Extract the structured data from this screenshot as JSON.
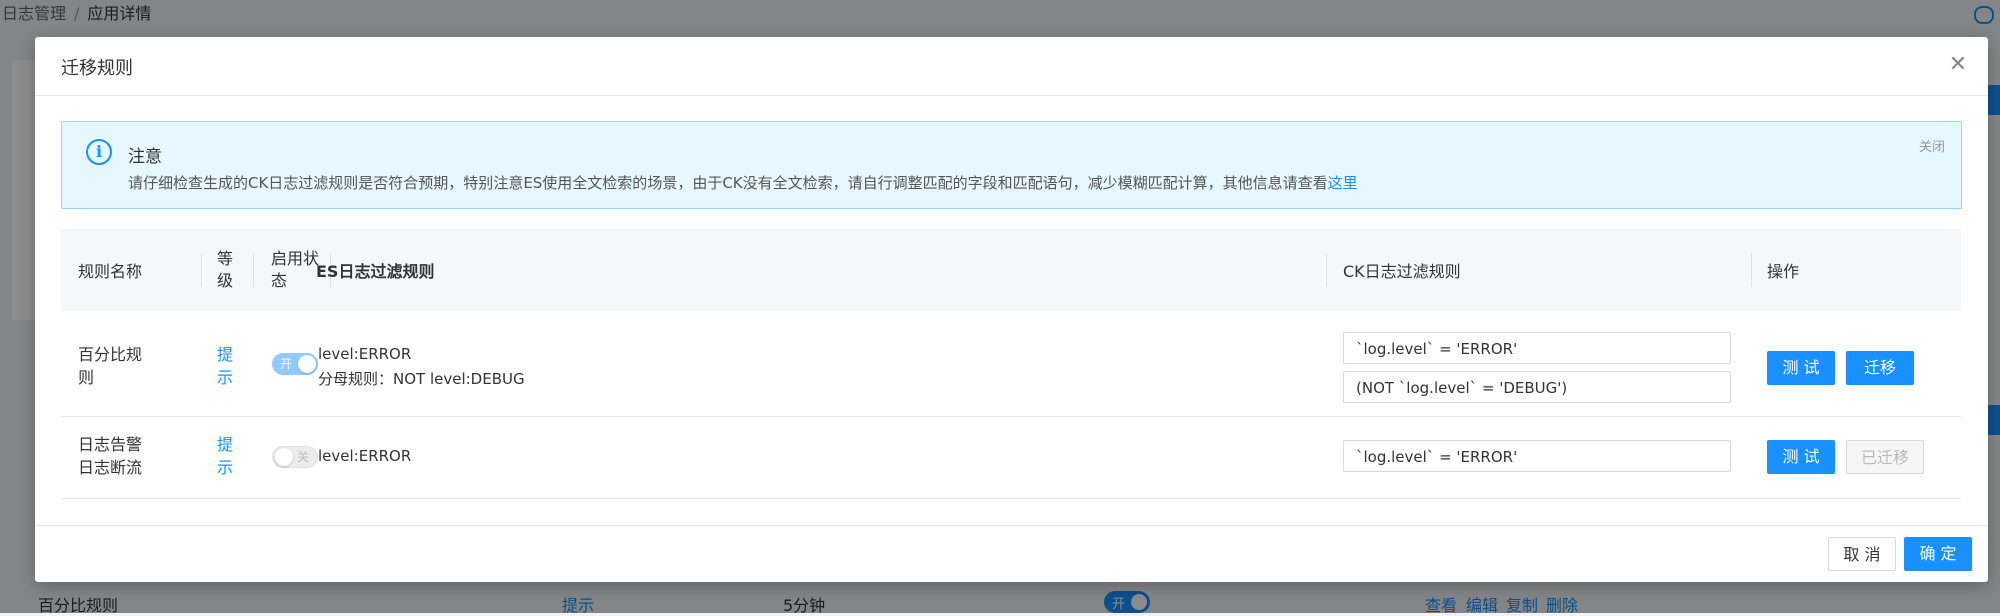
{
  "background": {
    "breadcrumb": [
      "日志管理",
      "应用详情"
    ],
    "breadcrumb_sep": "/",
    "row": {
      "name": "百分比规则",
      "hint": "提示",
      "interval": "5分钟",
      "toggle": "开",
      "actions": [
        "查看",
        "编辑",
        "复制",
        "删除"
      ]
    }
  },
  "modal": {
    "title": "迁移规则",
    "close_icon": "close-icon",
    "alert": {
      "icon": "info-icon",
      "title": "注意",
      "description": "请仔细检查生成的CK日志过滤规则是否符合预期，特别注意ES使用全文检索的场景，由于CK没有全文检索，请自行调整匹配的字段和匹配语句，减少模糊匹配计算，其他信息请查看",
      "link_text": "这里",
      "close_label": "关闭"
    },
    "table": {
      "headers": {
        "name": "规则名称",
        "level": "等级",
        "status": "启用状态",
        "es_rule": "ES日志过滤规则",
        "ck_rule": "CK日志过滤规则",
        "action": "操作"
      },
      "rows": [
        {
          "name": "百分比规则",
          "level": "提示",
          "enabled": true,
          "toggle_text": "开",
          "es_rule": [
            "level:ERROR",
            "分母规则：NOT level:DEBUG"
          ],
          "ck_rule": [
            "`log.level` = 'ERROR'",
            "(NOT `log.level` = 'DEBUG')"
          ],
          "test_label": "测 试",
          "migrate_label": "迁移",
          "migrated": false
        },
        {
          "name": "日志告警日志断流",
          "level": "提示",
          "enabled": false,
          "toggle_text": "关",
          "es_rule": [
            "level:ERROR"
          ],
          "ck_rule": [
            "`log.level` = 'ERROR'"
          ],
          "test_label": "测 试",
          "migrate_label": "已迁移",
          "migrated": true
        }
      ]
    },
    "footer": {
      "cancel_label": "取 消",
      "ok_label": "确 定"
    }
  },
  "colors": {
    "primary": "#1890ff",
    "alert_bg": "#e6f7ff",
    "alert_border": "#91d5ff"
  }
}
